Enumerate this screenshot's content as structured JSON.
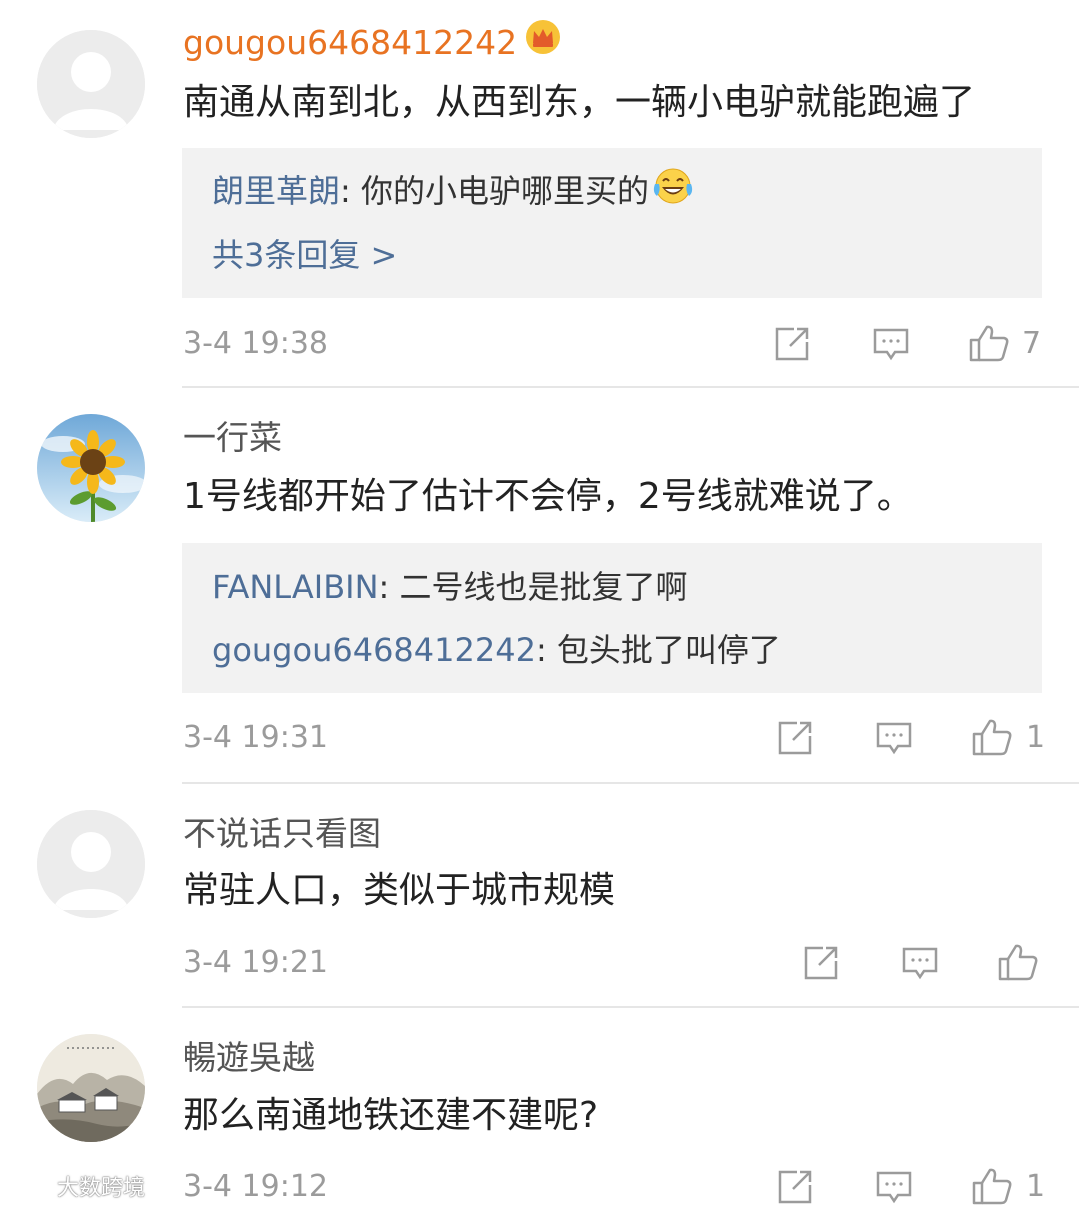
{
  "comments": [
    {
      "username": "gougou6468412242",
      "text": "南通从南到北，从西到东，一辆小电驴就能跑遍了",
      "reply_user": "朗里革朗",
      "reply_text": ": 你的小电驴哪里买的",
      "reply_more": "共3条回复 >",
      "time": "3-4 19:38",
      "likes": "7",
      "avatar_icon": "default-avatar-icon",
      "badge_icon": "crown-icon"
    },
    {
      "username": "一行菜",
      "text": "1号线都开始了估计不会停，2号线就难说了。",
      "replies": [
        {
          "user": "FANLAIBIN",
          "text": ": 二号线也是批复了啊"
        },
        {
          "user": "gougou6468412242",
          "text": ": 包头批了叫停了"
        }
      ],
      "time": "3-4 19:31",
      "likes": "1",
      "avatar_icon": "sunflower-avatar-icon"
    },
    {
      "username": "不说话只看图",
      "text": "常驻人口，类似于城市规模",
      "time": "3-4 19:21",
      "likes": "",
      "avatar_icon": "default-avatar-icon"
    },
    {
      "username": "暢遊吳越",
      "text": "那么南通地铁还建不建呢?",
      "time": "3-4 19:12",
      "likes": "1",
      "avatar_icon": "landscape-painting-avatar-icon"
    }
  ],
  "watermark": "大数跨境",
  "colors": {
    "vip_name": "#e87322",
    "reply_name": "#4e6e97",
    "reply_bg": "#f2f2f2",
    "muted": "#9b9b9b"
  }
}
